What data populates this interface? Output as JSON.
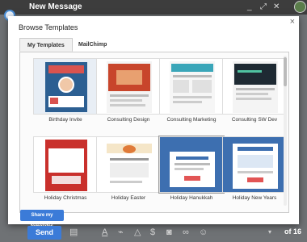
{
  "compose": {
    "title": "New Message",
    "minimize": "_",
    "expand": "⤢",
    "close": "✕",
    "send": "Send",
    "page": "of 16"
  },
  "modal": {
    "title": "Browse Templates",
    "close": "×",
    "tabs": [
      "My Templates",
      "MailChimp"
    ],
    "share_button": "Share my templates"
  },
  "templates": [
    {
      "label": "Birthday Invite"
    },
    {
      "label": "Consulting Design"
    },
    {
      "label": "Consulting Marketing"
    },
    {
      "label": "Consulting SW Dev"
    },
    {
      "label": "Holiday Christmas"
    },
    {
      "label": "Holiday Easter"
    },
    {
      "label": "Holiday Hanukkah"
    },
    {
      "label": "Holiday New Years"
    }
  ],
  "toolbar_icons": [
    "format-text-icon",
    "attach-icon",
    "drive-icon",
    "money-icon",
    "photo-icon",
    "link-icon",
    "emoji-icon",
    "more-icon"
  ],
  "colors": {
    "accent": "#3b7bd8",
    "title_bar": "#3d3d3d"
  }
}
